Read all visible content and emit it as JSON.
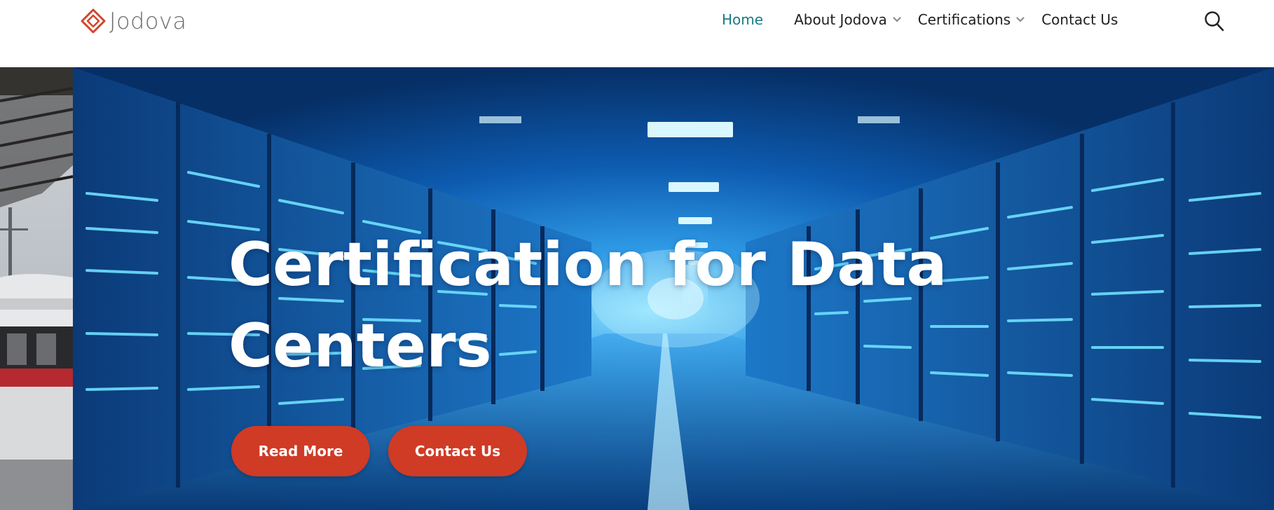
{
  "brand": {
    "name": "Jodova",
    "logo_icon": "diamond-logo-icon",
    "logo_color": "#d2452c",
    "text_color": "#6b6b6b"
  },
  "nav": {
    "items": [
      {
        "label": "Home",
        "active": true
      },
      {
        "label": "About Jodova",
        "has_submenu": true
      },
      {
        "label": "Certifications",
        "has_submenu": true
      },
      {
        "label": "Contact Us"
      }
    ],
    "active_color": "#1a7b84",
    "search_icon": "search-icon"
  },
  "hero": {
    "title": "Certification for Data Centers",
    "buttons": {
      "read_more": "Read More",
      "contact_us": "Contact Us"
    },
    "button_color": "#cf3b25"
  }
}
